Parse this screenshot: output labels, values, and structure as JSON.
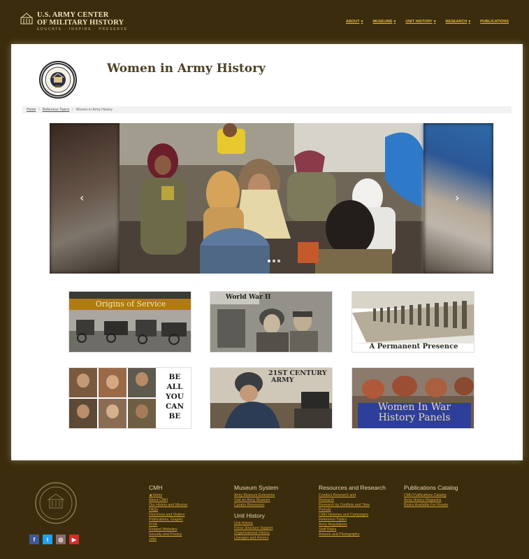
{
  "header": {
    "logo_line1": "U.S. ARMY CENTER",
    "logo_line2": "OF MILITARY HISTORY",
    "logo_line3": "EDUCATE · INSPIRE · PRESERVE",
    "nav": [
      {
        "label": "ABOUT"
      },
      {
        "label": "MUSEUMS"
      },
      {
        "label": "UNIT HISTORY"
      },
      {
        "label": "RESEARCH"
      },
      {
        "label": "PUBLICATIONS"
      }
    ]
  },
  "page": {
    "title": "Women in Army History",
    "breadcrumb": [
      "Home",
      "Reference Topics",
      "Women in Army History"
    ]
  },
  "carousel": {
    "prev_glyph": "‹",
    "next_glyph": "›",
    "slide_count": 3,
    "active_index": 0
  },
  "tiles": [
    {
      "caption": "Origins of Service"
    },
    {
      "caption": "World War II"
    },
    {
      "caption": "A Permanent Presence"
    },
    {
      "caption_lines": [
        "BE",
        "ALL",
        "YOU",
        "CAN",
        "BE"
      ]
    },
    {
      "caption_line1": "21ST CENTURY",
      "caption_line2": "ARMY"
    },
    {
      "caption_line1": "Women In War",
      "caption_line2": "History Panels"
    }
  ],
  "footer": {
    "social": [
      {
        "icon": "facebook-icon",
        "label": "f",
        "color": "#3b5998"
      },
      {
        "icon": "twitter-icon",
        "label": "t",
        "color": "#1da1f2"
      },
      {
        "icon": "flickr-icon",
        "label": "◎",
        "color": "#8a6a6a"
      },
      {
        "icon": "youtube-icon",
        "label": "▶",
        "color": "#d92a2a"
      }
    ],
    "columns": [
      {
        "heading": "CMH",
        "links": [
          "◀ Home",
          "About CMH",
          "Our History and Mission",
          "FAQs",
          "Directions and Visitors",
          "Publications, Graphic",
          "FOIA",
          "Related Websites",
          "Security and Privacy",
          "Jobs"
        ]
      },
      {
        "heading": "Museum System",
        "links": [
          "Army Museum Enterprise",
          "Visit an Army Museum",
          "Curator Resources"
        ],
        "heading2": "Unit History",
        "links2": [
          "Unit History",
          "Force Structure Support",
          "Organizational History",
          "Lineages and Honors"
        ]
      },
      {
        "heading": "Resources and Research",
        "links": [
          "Conduct Research and",
          "Research",
          "Research by Conflicts and Time",
          "Periods",
          "CMH Histories and Campaigns",
          "Reference Topics",
          "Army Regulations",
          "Staff Rides",
          "Artwork and Photography"
        ]
      },
      {
        "heading": "Publications Catalog",
        "links": [
          "CMH Publications Catalog",
          "Army History Magazine",
          "Books Available For Resale"
        ]
      }
    ]
  }
}
